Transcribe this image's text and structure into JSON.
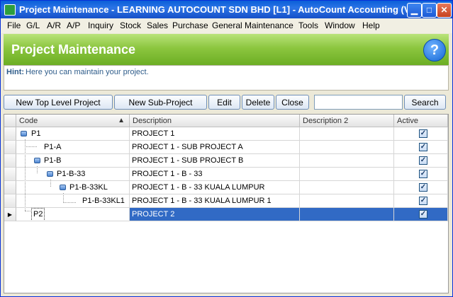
{
  "window": {
    "title": "Project Maintenance - LEARNING AUTOCOUNT SDN BHD [L1] - AutoCount Accounting (V...",
    "minimize_glyph": "▁",
    "maximize_glyph": "□",
    "close_glyph": "✕"
  },
  "menu": [
    "File",
    "G/L",
    "A/R",
    "A/P",
    "Inquiry",
    "Stock",
    "Sales",
    "Purchase",
    "General Maintenance",
    "Tools",
    "Window",
    "Help"
  ],
  "banner": {
    "title": "Project Maintenance",
    "help_glyph": "?"
  },
  "hint": {
    "label": "Hint:",
    "text": "Here you can maintain your project."
  },
  "toolbar": {
    "new_top_level": "New Top Level Project",
    "new_sub": "New Sub-Project",
    "edit": "Edit",
    "delete": "Delete",
    "close": "Close",
    "search_value": "",
    "search_button": "Search"
  },
  "grid": {
    "columns": {
      "code": "Code",
      "description": "Description",
      "description2": "Description 2",
      "active": "Active"
    },
    "sort_glyph": "▲",
    "rows": [
      {
        "code": "P1",
        "description": "PROJECT 1",
        "description2": "",
        "active": true
      },
      {
        "code": "P1-A",
        "description": "PROJECT 1 - SUB PROJECT A",
        "description2": "",
        "active": true
      },
      {
        "code": "P1-B",
        "description": "PROJECT 1 - SUB PROJECT B",
        "description2": "",
        "active": true
      },
      {
        "code": "P1-B-33",
        "description": "PROJECT 1 - B - 33",
        "description2": "",
        "active": true
      },
      {
        "code": "P1-B-33KL",
        "description": "PROJECT 1 - B - 33 KUALA LUMPUR",
        "description2": "",
        "active": true
      },
      {
        "code": "P1-B-33KL1",
        "description": "PROJECT 1 - B - 33 KUALA LUMPUR 1",
        "description2": "",
        "active": true
      },
      {
        "code": "P2",
        "description": "PROJECT 2",
        "description2": "",
        "active": true
      }
    ],
    "current_row_glyph": "▶",
    "check_glyph": "✓"
  }
}
